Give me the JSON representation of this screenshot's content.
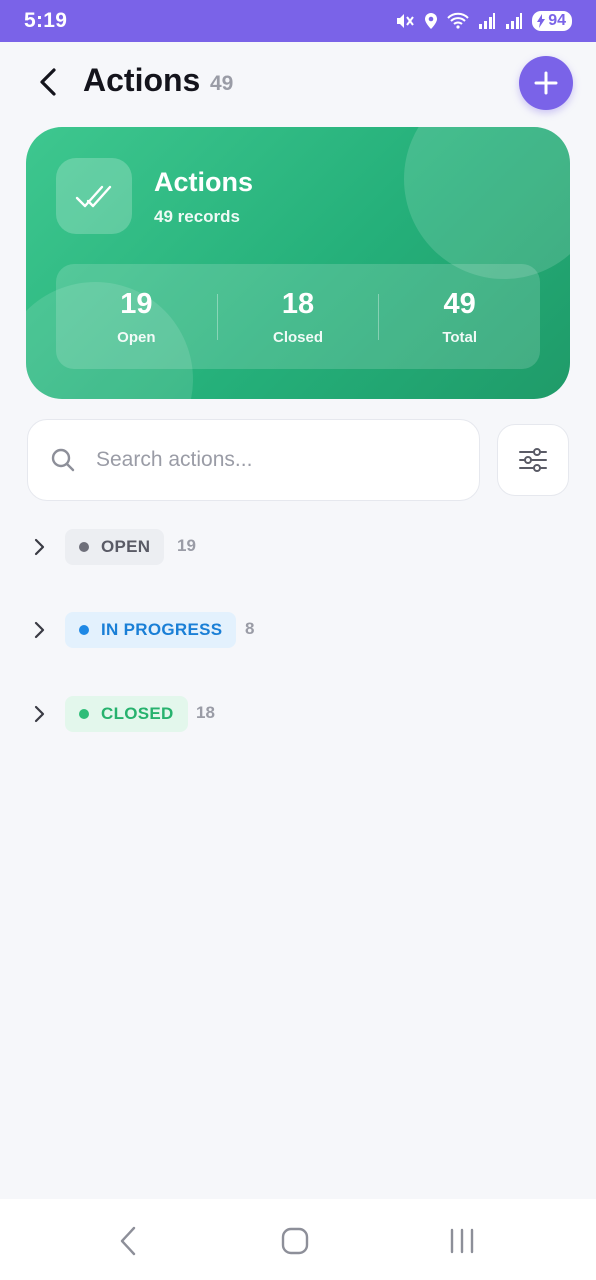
{
  "status_bar": {
    "time": "5:19",
    "battery": "94",
    "icons": [
      "mute-vibrate-icon",
      "location-icon",
      "wifi-icon",
      "signal-icon",
      "signal-icon",
      "battery-icon"
    ]
  },
  "header": {
    "title": "Actions",
    "count": "49",
    "back_icon": "chevron-left-icon",
    "add_icon": "plus-icon"
  },
  "summary": {
    "title": "Actions",
    "subtitle": "49 records",
    "icon": "double-check-icon",
    "stats": [
      {
        "value": "19",
        "label": "Open"
      },
      {
        "value": "18",
        "label": "Closed"
      },
      {
        "value": "49",
        "label": "Total"
      }
    ]
  },
  "search": {
    "placeholder": "Search actions...",
    "value": ""
  },
  "groups": [
    {
      "label": "OPEN",
      "count": "19",
      "dot_color": "#6e6f7a",
      "chip_bg": "#eceef2",
      "text_color": "#5a5b66"
    },
    {
      "label": "IN PROGRESS",
      "count": "8",
      "dot_color": "#1e88e5",
      "chip_bg": "#e3f1fd",
      "text_color": "#1a7fd6"
    },
    {
      "label": "CLOSED",
      "count": "18",
      "dot_color": "#2ebd78",
      "chip_bg": "#e3f7ec",
      "text_color": "#27b26e"
    }
  ],
  "colors": {
    "accent": "#7a63e8",
    "card_green": "#25b07a"
  }
}
